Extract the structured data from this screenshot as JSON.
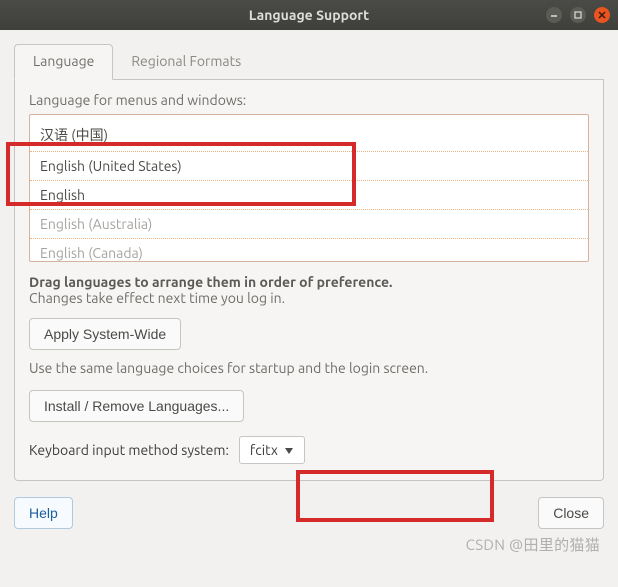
{
  "window": {
    "title": "Language Support"
  },
  "tabs": {
    "language": "Language",
    "regional": "Regional Formats"
  },
  "section": {
    "menus_label": "Language for menus and windows:"
  },
  "languages": [
    {
      "label": "汉语 (中国)",
      "dim": false
    },
    {
      "label": "English (United States)",
      "dim": false
    },
    {
      "label": "English",
      "dim": false
    },
    {
      "label": "English (Australia)",
      "dim": true
    },
    {
      "label": "English (Canada)",
      "dim": true
    }
  ],
  "hints": {
    "drag_bold": "Drag languages to arrange them in order of preference.",
    "drag_sub": "Changes take effect next time you log in."
  },
  "buttons": {
    "apply_system_wide": "Apply System-Wide",
    "install_remove": "Install / Remove Languages...",
    "help": "Help",
    "close": "Close"
  },
  "desc": {
    "same_choices": "Use the same language choices for startup and the login screen."
  },
  "input_method": {
    "label": "Keyboard input method system:",
    "selected": "fcitx"
  },
  "watermark": "CSDN @田里的猫猫"
}
